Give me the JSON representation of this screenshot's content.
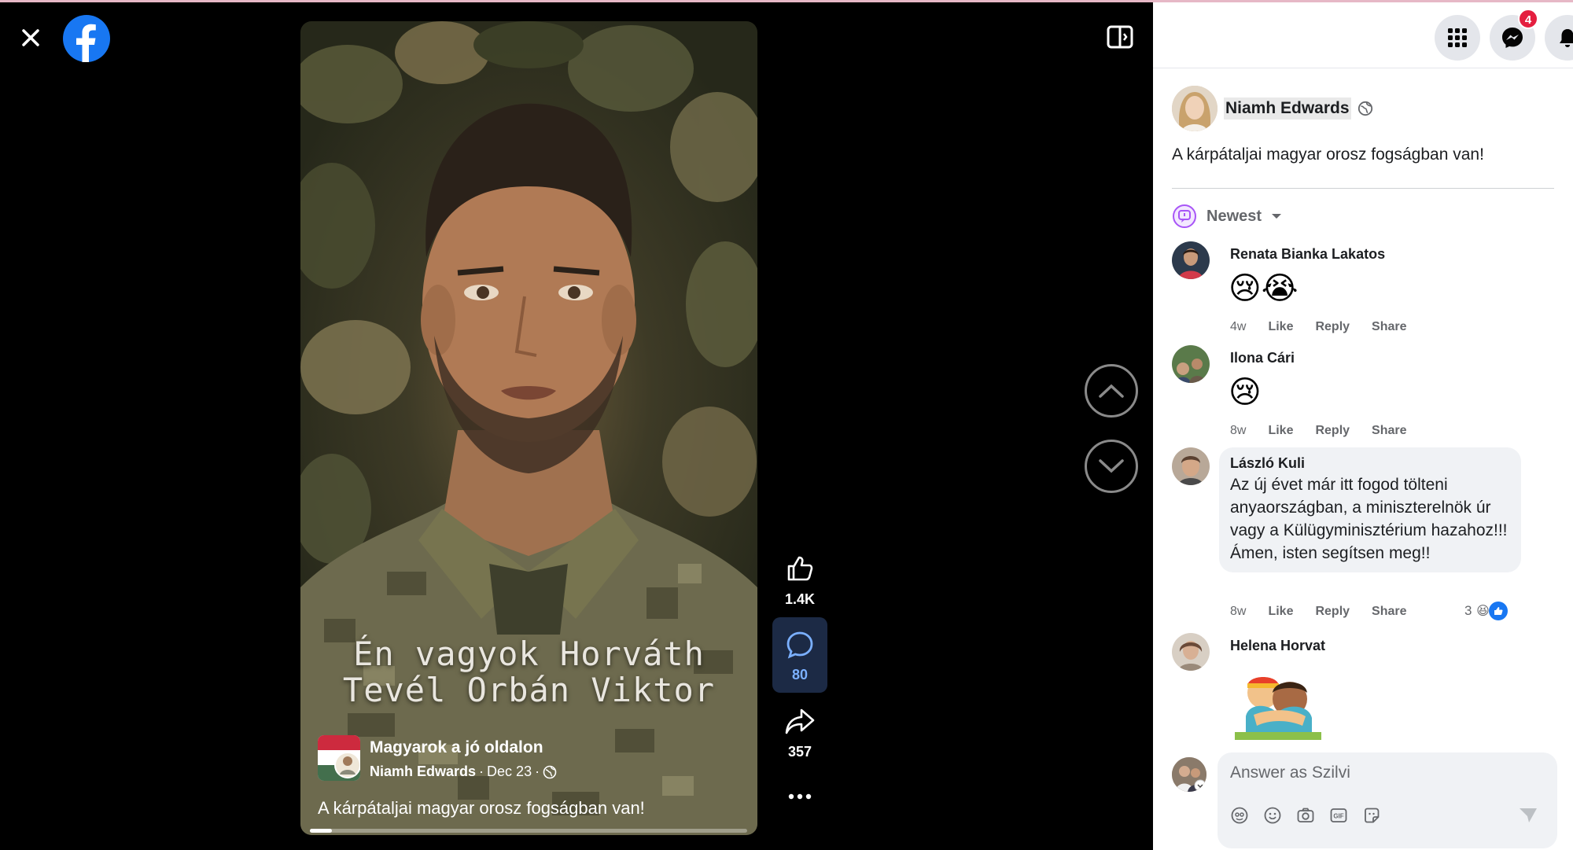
{
  "viewer": {
    "video": {
      "subtitle_line1": "Én vagyok Horváth",
      "subtitle_line2": "Tevél Orbán Viktor",
      "page_name": "Magyarok a jó oldalon",
      "author": "Niamh Edwards",
      "date": "Dec 23",
      "caption": "A kárpátaljai magyar orosz fogságban van!",
      "progress_fraction": 0.05
    },
    "actions": {
      "like_count": "1.4K",
      "comment_count": "80",
      "share_count": "357"
    }
  },
  "header": {
    "notification_badge": "4"
  },
  "post": {
    "author": "Niamh Edwards",
    "text": "A kárpátaljai magyar orosz fogságban van!"
  },
  "comments_sort": "Newest",
  "comments": [
    {
      "name": "Renata Bianka Lakatos",
      "emoji": "😢😭",
      "time": "4w",
      "like": "Like",
      "reply": "Reply",
      "share": "Share"
    },
    {
      "name": "Ilona Cári",
      "emoji": "😢",
      "time": "8w",
      "like": "Like",
      "reply": "Reply",
      "share": "Share"
    },
    {
      "name": "László Kuli",
      "text": "Az új évet már itt fogod tölteni anyaországban, a miniszterelnök úr vagy a Külügyminisztérium hazahoz!!! Ámen, isten segítsen meg!!",
      "time": "8w",
      "like": "Like",
      "reply": "Reply",
      "share": "Share",
      "reaction_count": "3"
    },
    {
      "name": "Helena Horvat"
    }
  ],
  "composer": {
    "placeholder": "Answer as Szilvi"
  },
  "icons": [
    "close-icon",
    "facebook-logo-icon",
    "layout-toggle-icon",
    "like-icon",
    "comment-icon",
    "share-icon",
    "more-icon",
    "chevron-up-icon",
    "chevron-down-icon",
    "menu-grid-icon",
    "messenger-icon",
    "bell-icon",
    "globe-icon",
    "sort-icon",
    "avatar-icon",
    "emoji-icon",
    "camera-icon",
    "gif-icon",
    "sticker-icon",
    "send-icon"
  ],
  "colors": {
    "facebook_blue": "#1877f2",
    "badge_red": "#e41e3f",
    "comment_active": "#7bb0ff"
  }
}
